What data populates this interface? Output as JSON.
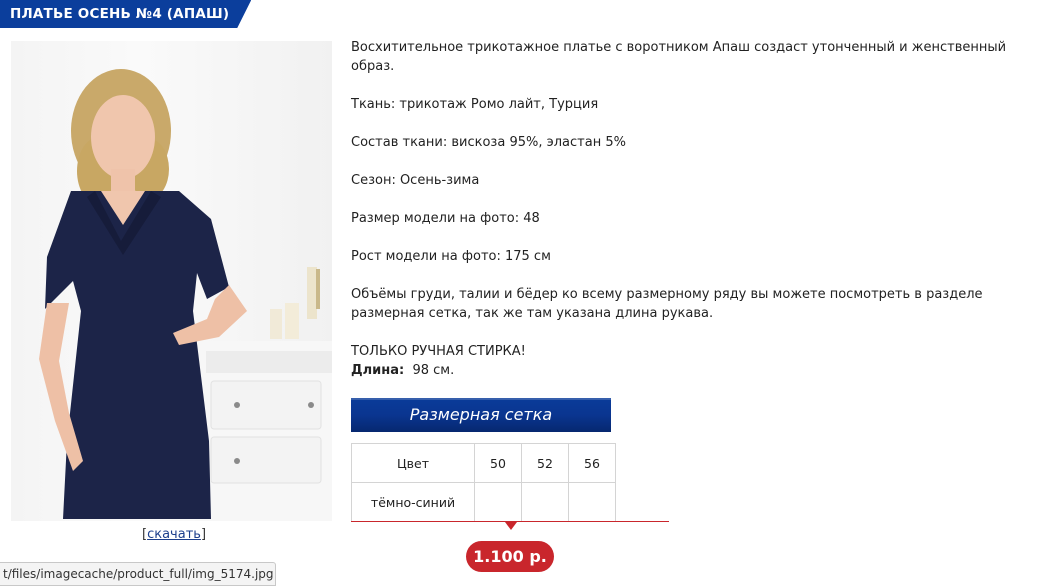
{
  "product": {
    "title": "ПЛАТЬЕ ОСЕНЬ №4 (АПАШ)",
    "download_label": "скачать",
    "status_url": "t/files/imagecache/product_full/img_5174.jpg",
    "description": [
      "Восхитительное трикотажное платье с воротником Апаш создаст утонченный и женственный образ.",
      "Ткань: трикотаж Ромо лайт, Турция",
      "Состав ткани: вискоза 95%, эластан 5%",
      "Сезон: Осень-зима",
      "Размер модели на фото: 48",
      "Рост модели на фото: 175 см",
      "Объёмы груди, талии и бёдер ко всему размерному ряду вы можете посмотреть в разделе размерная сетка, так же там указана длина рукава."
    ],
    "wash_note": "ТОЛЬКО РУЧНАЯ СТИРКА!",
    "length_label": "Длина:",
    "length_value": "98 см.",
    "size_chart_button": "Размерная сетка",
    "table": {
      "header_label": "Цвет",
      "sizes": [
        "50",
        "52",
        "56"
      ],
      "color_name": "тёмно-синий"
    },
    "price": "1.100 р."
  },
  "colors": {
    "banner_blue": "#0b3e9c",
    "banner_red": "#d2222a",
    "price_red": "#c9262c",
    "dress_navy": "#1c2448"
  }
}
